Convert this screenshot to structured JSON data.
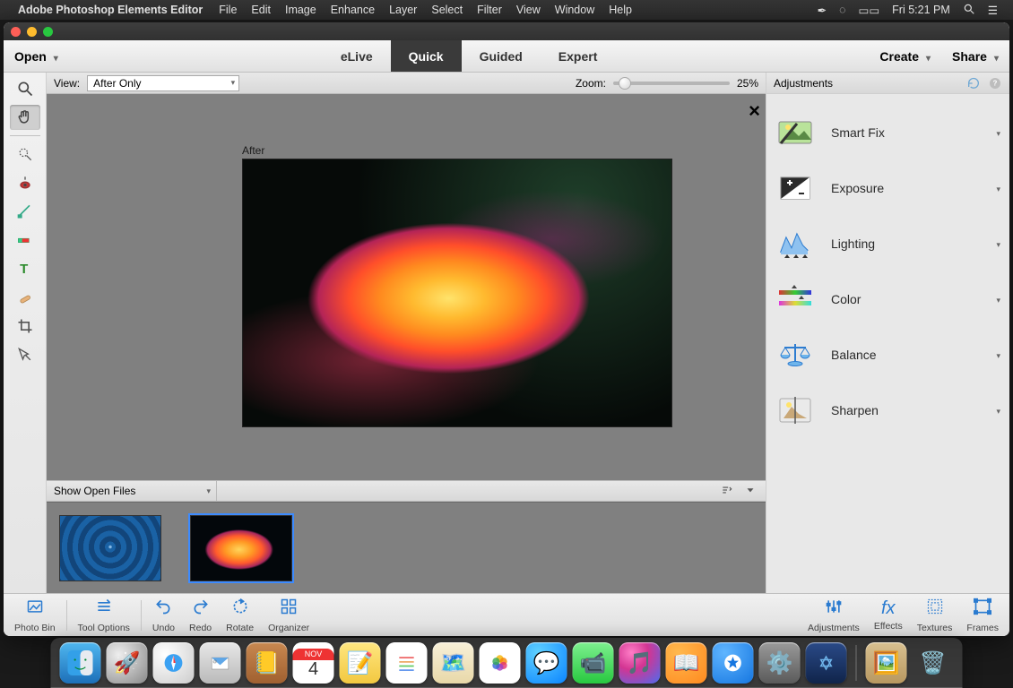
{
  "menubar": {
    "app": "Adobe Photoshop Elements Editor",
    "items": [
      "File",
      "Edit",
      "Image",
      "Enhance",
      "Layer",
      "Select",
      "Filter",
      "View",
      "Window",
      "Help"
    ],
    "clock": "Fri 5:21 PM"
  },
  "topbar": {
    "open": "Open",
    "tabs": [
      "eLive",
      "Quick",
      "Guided",
      "Expert"
    ],
    "active_tab": "Quick",
    "create": "Create",
    "share": "Share"
  },
  "viewbar": {
    "label": "View:",
    "view_mode": "After Only",
    "zoom_label": "Zoom:",
    "zoom_value": "25%"
  },
  "canvas": {
    "label": "After"
  },
  "binbar": {
    "dropdown": "Show Open Files"
  },
  "adjustments": {
    "title": "Adjustments",
    "items": [
      {
        "label": "Smart Fix",
        "icon": "smartfix"
      },
      {
        "label": "Exposure",
        "icon": "exposure"
      },
      {
        "label": "Lighting",
        "icon": "lighting"
      },
      {
        "label": "Color",
        "icon": "color"
      },
      {
        "label": "Balance",
        "icon": "balance"
      },
      {
        "label": "Sharpen",
        "icon": "sharpen"
      }
    ]
  },
  "bottombar": {
    "left": [
      {
        "label": "Photo Bin",
        "name": "photo-bin"
      },
      {
        "label": "Tool Options",
        "name": "tool-options"
      },
      {
        "label": "Undo",
        "name": "undo"
      },
      {
        "label": "Redo",
        "name": "redo"
      },
      {
        "label": "Rotate",
        "name": "rotate"
      },
      {
        "label": "Organizer",
        "name": "organizer"
      }
    ],
    "right": [
      {
        "label": "Adjustments",
        "name": "adjustments-tab"
      },
      {
        "label": "Effects",
        "name": "effects"
      },
      {
        "label": "Textures",
        "name": "textures"
      },
      {
        "label": "Frames",
        "name": "frames"
      }
    ]
  },
  "tools": [
    "zoom",
    "hand",
    "quick-select",
    "redeye",
    "whiten",
    "quick-brush",
    "type",
    "spot-heal",
    "crop",
    "move"
  ],
  "selected_tool": "hand",
  "dock": {
    "calendar_month": "NOV",
    "calendar_day": "4"
  }
}
